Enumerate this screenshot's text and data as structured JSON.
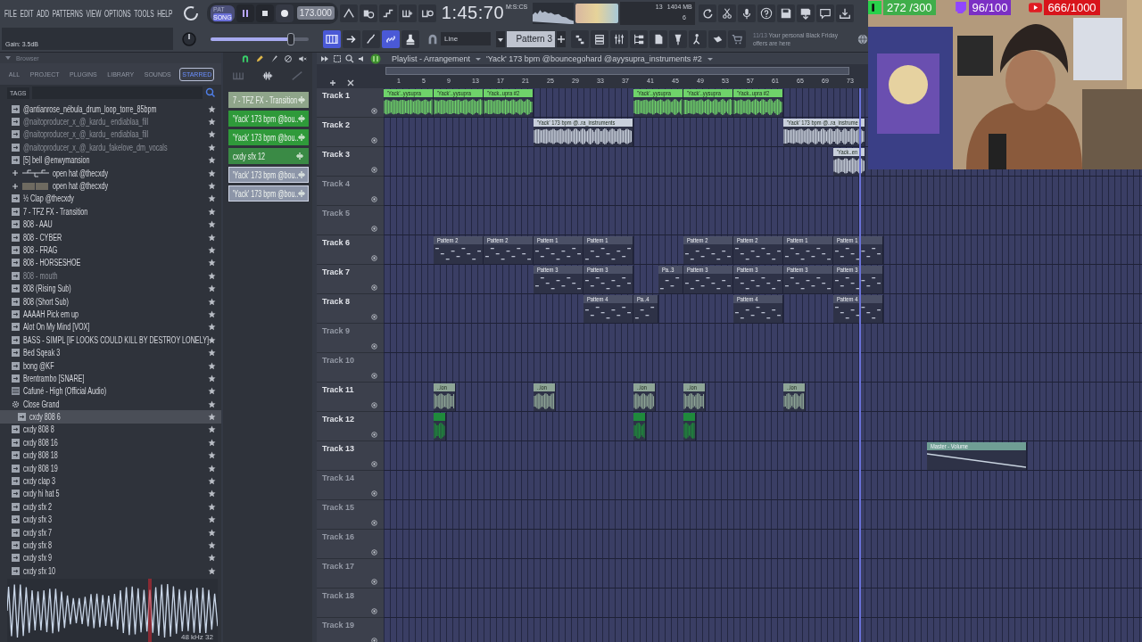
{
  "menu": [
    "FILE",
    "EDIT",
    "ADD",
    "PATTERNS",
    "VIEW",
    "OPTIONS",
    "TOOLS",
    "HELP"
  ],
  "transport": {
    "modes": [
      {
        "label": "PAT",
        "selected": false
      },
      {
        "label": "SONG",
        "selected": true
      }
    ],
    "playing": true,
    "tempo": "173.000"
  },
  "time": {
    "value": "1:45:70",
    "unit": "M:S:CS"
  },
  "cpu": {
    "value": "13",
    "memory": "1404 MB",
    "polyphony": "6"
  },
  "hint": {
    "text": "Gain: 3.5dB"
  },
  "master": {
    "level": 0.82
  },
  "tools": [
    {
      "selected": true
    },
    {
      "selected": false
    },
    {
      "selected": false
    },
    {
      "selected": true
    },
    {
      "selected": false
    }
  ],
  "snap": {
    "value": "Line"
  },
  "pattern": {
    "value": "Pattern 3"
  },
  "news": {
    "count": "11/13",
    "text": "Your personal Black Friday offers are here"
  },
  "browser": {
    "title": "Browser",
    "tabs": [
      {
        "label": "ALL",
        "selected": false
      },
      {
        "label": "PROJECT",
        "selected": false
      },
      {
        "label": "PLUGINS",
        "selected": false
      },
      {
        "label": "LIBRARY",
        "selected": false
      },
      {
        "label": "SOUNDS",
        "selected": false
      },
      {
        "label": "STARRED",
        "selected": true
      }
    ],
    "tags_label": "TAGS",
    "items": [
      {
        "label": "@antianrose_nébula_drum_loop_torre_85bpm",
        "kind": "sample",
        "dimmed": false,
        "selected": false
      },
      {
        "label": "@naitoproducer_x_@_kardu_ endiablaa_fill",
        "kind": "sample",
        "dimmed": true,
        "selected": false
      },
      {
        "label": "@naitoproducer_x_@_kardu_ endiablaa_fill",
        "kind": "sample",
        "dimmed": true,
        "selected": false
      },
      {
        "label": "@naitoproducer_x_@_kardu_fakelove_dm_vocals",
        "kind": "sample",
        "dimmed": true,
        "selected": false
      },
      {
        "label": "[5] bell @enwymansion",
        "kind": "sample",
        "dimmed": false,
        "selected": false
      },
      {
        "label": "open hat @thecxdy",
        "kind": "pack",
        "dimmed": false,
        "selected": false
      },
      {
        "label": "open hat @thecxdy",
        "kind": "pack",
        "dimmed": false,
        "selected": false
      },
      {
        "label": "½ Clap @thecxdy",
        "kind": "sample",
        "dimmed": false,
        "selected": false
      },
      {
        "label": "7 - TFZ FX - Transition",
        "kind": "sample",
        "dimmed": false,
        "selected": false
      },
      {
        "label": "808 - AAU",
        "kind": "sample",
        "dimmed": false,
        "selected": false
      },
      {
        "label": "808 - CYBER",
        "kind": "sample",
        "dimmed": false,
        "selected": false
      },
      {
        "label": "808 - FRAG",
        "kind": "sample",
        "dimmed": false,
        "selected": false
      },
      {
        "label": "808 - HORSESHOE",
        "kind": "sample",
        "dimmed": false,
        "selected": false
      },
      {
        "label": "808 - mouth",
        "kind": "sample",
        "dimmed": true,
        "selected": false
      },
      {
        "label": "808 (Rising Sub)",
        "kind": "sample",
        "dimmed": false,
        "selected": false
      },
      {
        "label": "808 (Short Sub)",
        "kind": "sample",
        "dimmed": false,
        "selected": false
      },
      {
        "label": "AAAAH Pick em up",
        "kind": "sample",
        "dimmed": false,
        "selected": false
      },
      {
        "label": "Alot On My Mind [VOX]",
        "kind": "sample",
        "dimmed": false,
        "selected": false
      },
      {
        "label": "BASS - SIMPL [IF LOOKS COULD KILL BY DESTROY LONELY]",
        "kind": "sample",
        "dimmed": false,
        "selected": false
      },
      {
        "label": "Bed Sqeak 3",
        "kind": "sample",
        "dimmed": false,
        "selected": false
      },
      {
        "label": "bong @KF",
        "kind": "sample",
        "dimmed": false,
        "selected": false
      },
      {
        "label": "Brentrambo [SNARE]",
        "kind": "sample",
        "dimmed": false,
        "selected": false
      },
      {
        "label": "Cafuné - High (Official Audio)",
        "kind": "audio",
        "dimmed": false,
        "selected": false
      },
      {
        "label": "Close Grand",
        "kind": "plugin",
        "dimmed": false,
        "selected": false
      },
      {
        "label": "cxdy 808 6",
        "kind": "sample",
        "dimmed": false,
        "selected": true
      },
      {
        "label": "cxdy 808 8",
        "kind": "sample",
        "dimmed": false,
        "selected": false
      },
      {
        "label": "cxdy 808 16",
        "kind": "sample",
        "dimmed": false,
        "selected": false
      },
      {
        "label": "cxdy 808 18",
        "kind": "sample",
        "dimmed": false,
        "selected": false
      },
      {
        "label": "cxdy 808 19",
        "kind": "sample",
        "dimmed": false,
        "selected": false
      },
      {
        "label": "cxdy clap 3",
        "kind": "sample",
        "dimmed": false,
        "selected": false
      },
      {
        "label": "cxdy hi hat 5",
        "kind": "sample",
        "dimmed": false,
        "selected": false
      },
      {
        "label": "cxdy sfx 2",
        "kind": "sample",
        "dimmed": false,
        "selected": false
      },
      {
        "label": "cxdy sfx 3",
        "kind": "sample",
        "dimmed": false,
        "selected": false
      },
      {
        "label": "cxdy sfx 7",
        "kind": "sample",
        "dimmed": false,
        "selected": false
      },
      {
        "label": "cxdy sfx 8",
        "kind": "sample",
        "dimmed": false,
        "selected": false
      },
      {
        "label": "cxdy sfx 9",
        "kind": "sample",
        "dimmed": false,
        "selected": false
      },
      {
        "label": "cxdy sfx 10",
        "kind": "sample",
        "dimmed": false,
        "selected": false
      }
    ],
    "preview_info": "48 kHz 32"
  },
  "picker": [
    {
      "label": "7 - TFZ FX - Transition",
      "color": "#8fa58a",
      "selected": false
    },
    {
      "label": "'Yack' 173 bpm @bou..",
      "color": "#2f9a3a",
      "selected": false
    },
    {
      "label": "'Yack' 173 bpm @bou..",
      "color": "#2f9a3a",
      "selected": false
    },
    {
      "label": "cxdy sfx 12",
      "color": "#3a8a45",
      "selected": false
    },
    {
      "label": "'Yack' 173 bpm @bou..",
      "color": "#8c95a8",
      "selected": true
    },
    {
      "label": "'Yack' 173 bpm @bou..",
      "color": "#8c95a8",
      "selected": true
    }
  ],
  "playlist": {
    "title": "Playlist - Arrangement",
    "subtitle": "'Yack' 173 bpm @bouncegohard @ayysupra_instruments #2",
    "ruler": [
      "1",
      "5",
      "9",
      "13",
      "17",
      "21",
      "25",
      "29",
      "33",
      "37",
      "41",
      "45",
      "49",
      "53",
      "57",
      "61",
      "65",
      "69",
      "73"
    ],
    "tracks": [
      {
        "name": "Track 1",
        "dimmed": false,
        "clips": [
          {
            "kind": "audio",
            "label": "'Yack'..yysupra",
            "color": "#6fd36a"
          },
          {
            "kind": "audio",
            "label": "'Yack'..yysupra",
            "color": "#6fd36a"
          },
          {
            "kind": "audio",
            "label": "'Yack..upra #2",
            "color": "#6fd36a"
          },
          {
            "kind": "audio",
            "label": "'Yack'..yysupra",
            "color": "#6fd36a"
          },
          {
            "kind": "audio",
            "label": "'Yack'..yysupra",
            "color": "#6fd36a"
          },
          {
            "kind": "audio",
            "label": "'Yack..upra #2",
            "color": "#6fd36a"
          }
        ]
      },
      {
        "name": "Track 2",
        "dimmed": false,
        "clips": [
          {
            "kind": "audio",
            "label": "'Yack' 173 bpm @..ra_instruments",
            "color": "#c9d0dc"
          },
          {
            "kind": "audio",
            "label": "'Yack' 173 bpm @..ra_instrume",
            "color": "#c9d0dc"
          }
        ]
      },
      {
        "name": "Track 3",
        "dimmed": false,
        "clips": [
          {
            "kind": "audio",
            "label": "'Yack..en",
            "color": "#c9d0dc"
          }
        ]
      },
      {
        "name": "Track 4",
        "dimmed": true
      },
      {
        "name": "Track 5",
        "dimmed": true
      },
      {
        "name": "Track 6",
        "dimmed": false,
        "clips": [
          {
            "kind": "pattern",
            "label": "Pattern 2"
          },
          {
            "kind": "pattern",
            "label": "Pattern 2"
          },
          {
            "kind": "pattern",
            "label": "Pattern 1"
          },
          {
            "kind": "pattern",
            "label": "Pattern 1"
          },
          {
            "kind": "pattern",
            "label": "Pattern 2"
          },
          {
            "kind": "pattern",
            "label": "Pattern 2"
          },
          {
            "kind": "pattern",
            "label": "Pattern 1"
          },
          {
            "kind": "pattern",
            "label": "Pattern 1"
          }
        ]
      },
      {
        "name": "Track 7",
        "dimmed": false,
        "clips": [
          {
            "kind": "pattern",
            "label": "Pattern 3"
          },
          {
            "kind": "pattern",
            "label": "Pattern 3"
          },
          {
            "kind": "pattern",
            "label": "Pa..3"
          },
          {
            "kind": "pattern",
            "label": "Pattern 3"
          },
          {
            "kind": "pattern",
            "label": "Pattern 3"
          },
          {
            "kind": "pattern",
            "label": "Pattern 3"
          },
          {
            "kind": "pattern",
            "label": "Pattern 3"
          }
        ]
      },
      {
        "name": "Track 8",
        "dimmed": false,
        "clips": [
          {
            "kind": "pattern",
            "label": "Pattern 4"
          },
          {
            "kind": "pattern",
            "label": "Pa..4"
          },
          {
            "kind": "pattern",
            "label": "Pattern 4"
          },
          {
            "kind": "pattern",
            "label": "Pattern 4"
          }
        ]
      },
      {
        "name": "Track 9",
        "dimmed": true
      },
      {
        "name": "Track 10",
        "dimmed": true
      },
      {
        "name": "Track 11",
        "dimmed": false,
        "clips": [
          {
            "kind": "audio",
            "label": "..ion",
            "color": "#8ea596"
          },
          {
            "kind": "audio",
            "label": "..ion",
            "color": "#8ea596"
          },
          {
            "kind": "audio",
            "label": "..ion",
            "color": "#8ea596"
          },
          {
            "kind": "audio",
            "label": "..ion",
            "color": "#8ea596"
          },
          {
            "kind": "audio",
            "label": "..ion",
            "color": "#8ea596"
          }
        ]
      },
      {
        "name": "Track 12",
        "dimmed": false,
        "clips": [
          {
            "kind": "audio",
            "color": "#1f8a3c"
          },
          {
            "kind": "audio",
            "color": "#1f8a3c"
          },
          {
            "kind": "audio",
            "color": "#1f8a3c"
          }
        ]
      },
      {
        "name": "Track 13",
        "dimmed": false,
        "clips": [
          {
            "kind": "automation",
            "label": "Master - Volume",
            "color": "#6f9e94"
          }
        ]
      },
      {
        "name": "Track 14",
        "dimmed": true
      },
      {
        "name": "Track 15",
        "dimmed": true
      },
      {
        "name": "Track 16",
        "dimmed": true
      },
      {
        "name": "Track 17",
        "dimmed": true
      },
      {
        "name": "Track 18",
        "dimmed": true
      },
      {
        "name": "Track 19",
        "dimmed": true
      }
    ]
  },
  "stream": {
    "counters": [
      {
        "text": "272 /300",
        "color": "#3fae4a"
      },
      {
        "text": "96/100",
        "color": "#7b2fc4"
      },
      {
        "text": "666/1000",
        "color": "#d8141b"
      }
    ]
  }
}
